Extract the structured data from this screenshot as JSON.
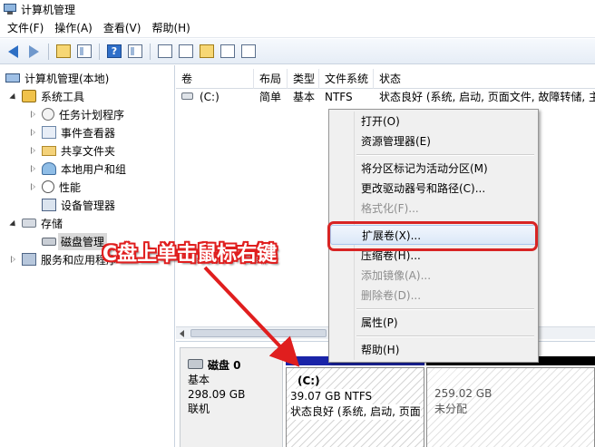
{
  "window": {
    "title": "计算机管理"
  },
  "menubar": [
    {
      "label": "文件(F)"
    },
    {
      "label": "操作(A)"
    },
    {
      "label": "查看(V)"
    },
    {
      "label": "帮助(H)"
    }
  ],
  "tree": {
    "root": "计算机管理(本地)",
    "system_tools": "系统工具",
    "task_scheduler": "任务计划程序",
    "event_viewer": "事件查看器",
    "shared_folders": "共享文件夹",
    "local_users": "本地用户和组",
    "performance": "性能",
    "device_manager": "设备管理器",
    "storage": "存储",
    "disk_management": "磁盘管理",
    "services": "服务和应用程序"
  },
  "volume_list": {
    "columns": [
      "卷",
      "布局",
      "类型",
      "文件系统",
      "状态"
    ],
    "rows": [
      {
        "volume": "(C:)",
        "layout": "简单",
        "type": "基本",
        "fs": "NTFS",
        "status": "状态良好 (系统, 启动, 页面文件, 故障转储, 主"
      }
    ]
  },
  "disk": {
    "name": "磁盘 0",
    "type": "基本",
    "size": "298.09 GB",
    "status": "联机",
    "partition_c": {
      "label": "(C:)",
      "size": "39.07 GB NTFS",
      "status": "状态良好 (系统, 启动, 页面"
    },
    "unallocated": {
      "size": "259.02 GB",
      "label": "未分配"
    }
  },
  "context_menu": {
    "open": "打开(O)",
    "explorer": "资源管理器(E)",
    "mark_active": "将分区标记为活动分区(M)",
    "change_letter": "更改驱动器号和路径(C)...",
    "format": "格式化(F)...",
    "extend": "扩展卷(X)...",
    "shrink": "压缩卷(H)...",
    "add_mirror": "添加镜像(A)...",
    "delete": "删除卷(D)...",
    "properties": "属性(P)",
    "help": "帮助(H)"
  },
  "annotation": {
    "text": "C盘上单击鼠标右键"
  },
  "colors": {
    "annotation_red": "#e01e1e",
    "highlight_red": "#d82424",
    "partition_blue": "#1a24a8"
  }
}
